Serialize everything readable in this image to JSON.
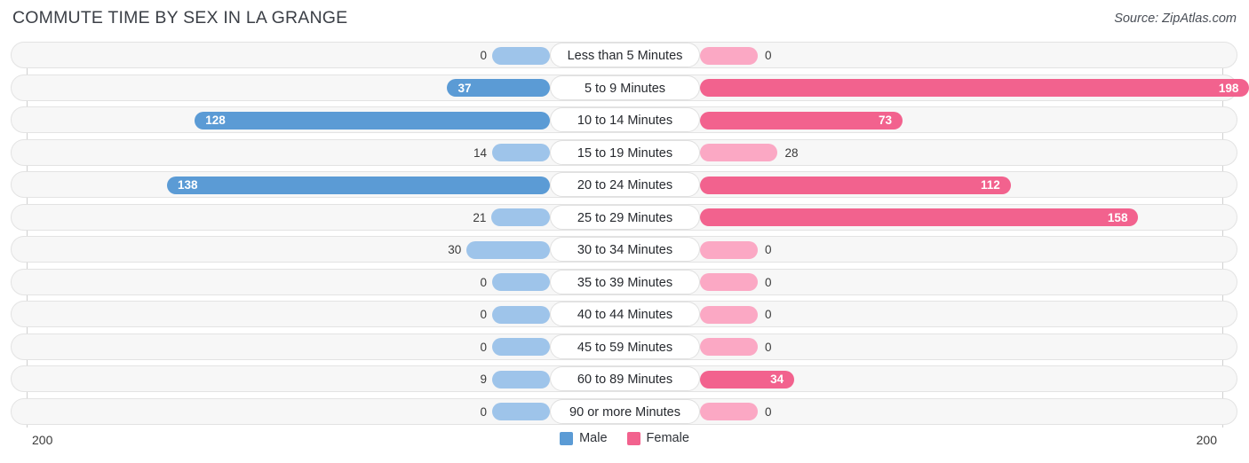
{
  "header": {
    "title": "COMMUTE TIME BY SEX IN LA GRANGE",
    "source": "Source: ZipAtlas.com"
  },
  "axis": {
    "left_max_label": "200",
    "right_max_label": "200",
    "max": 200
  },
  "legend": [
    {
      "label": "Male",
      "color": "#5b9bd5"
    },
    {
      "label": "Female",
      "color": "#f2628e"
    }
  ],
  "colors": {
    "male_light": "#9ec4ea",
    "male_dark": "#5b9bd5",
    "female_light": "#fba8c4",
    "female_dark": "#f2628e",
    "track": "#f7f7f7",
    "track_border": "#e3e3e3"
  },
  "chart_data": {
    "type": "bar",
    "title": "COMMUTE TIME BY SEX IN LA GRANGE",
    "subtitle": "Source: ZipAtlas.com",
    "orientation": "horizontal-diverging",
    "xlabel": "",
    "ylabel": "",
    "xlim": [
      200,
      200
    ],
    "grid": false,
    "legend_position": "bottom-center",
    "categories": [
      "Less than 5 Minutes",
      "5 to 9 Minutes",
      "10 to 14 Minutes",
      "15 to 19 Minutes",
      "20 to 24 Minutes",
      "25 to 29 Minutes",
      "30 to 34 Minutes",
      "35 to 39 Minutes",
      "40 to 44 Minutes",
      "45 to 59 Minutes",
      "60 to 89 Minutes",
      "90 or more Minutes"
    ],
    "series": [
      {
        "name": "Male",
        "values": [
          0,
          37,
          128,
          14,
          138,
          21,
          30,
          0,
          0,
          0,
          9,
          0
        ]
      },
      {
        "name": "Female",
        "values": [
          0,
          198,
          73,
          28,
          112,
          158,
          0,
          0,
          0,
          0,
          34,
          0
        ]
      }
    ]
  }
}
